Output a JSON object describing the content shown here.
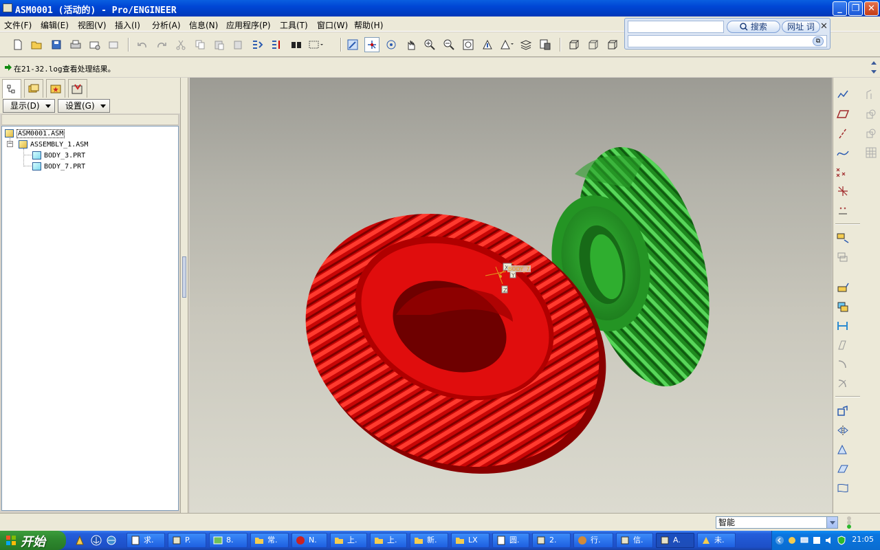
{
  "window": {
    "title": "ASM0001 (活动的) - Pro/ENGINEER",
    "buttons": {
      "minimize": "_",
      "maximize": "❐",
      "close": "✕"
    }
  },
  "menu": [
    "文件(F)",
    "编辑(E)",
    "视图(V)",
    "插入(I)",
    "分析(A)",
    "信息(N)",
    "应用程序(P)",
    "工具(T)",
    "窗口(W)",
    "帮助(H)"
  ],
  "search_widget": {
    "search_label": "搜索",
    "url_label": "网址 词",
    "close": "✕"
  },
  "message_line": {
    "text": "在21-32.log查看处理结果。"
  },
  "navigator": {
    "show_label": "显示(D)",
    "settings_label": "设置(G)",
    "tree": [
      {
        "label": "ASM0001.ASM",
        "kind": "asm"
      },
      {
        "label": "ASSEMBLY_1.ASM",
        "kind": "asm",
        "toggle": "−"
      },
      {
        "label": "BODY_3.PRT",
        "kind": "prt"
      },
      {
        "label": "BODY_7.PRT",
        "kind": "prt"
      }
    ]
  },
  "viewport": {
    "csys_label": "BODY_7",
    "axis_labels": {
      "x": "X",
      "y": "Y",
      "z": "Z"
    },
    "gear_colors": {
      "large": "#d50a0a",
      "small": "#2a9e2a"
    }
  },
  "statusbar": {
    "filter_value": "智能"
  },
  "taskbar": {
    "start_label": "开始",
    "tasks": [
      {
        "label": "求.",
        "icon": "doc-icon"
      },
      {
        "label": "P.",
        "icon": "proe-icon"
      },
      {
        "label": "8.",
        "icon": "image-icon"
      },
      {
        "label": "常.",
        "icon": "folder-icon"
      },
      {
        "label": "N.",
        "icon": "app-icon"
      },
      {
        "label": "上.",
        "icon": "folder-icon"
      },
      {
        "label": "上.",
        "icon": "folder-icon"
      },
      {
        "label": "新.",
        "icon": "folder-icon"
      },
      {
        "label": "LX",
        "icon": "folder-icon"
      },
      {
        "label": "圆.",
        "icon": "doc-icon"
      },
      {
        "label": "2.",
        "icon": "proe-icon"
      },
      {
        "label": "行.",
        "icon": "app-icon"
      },
      {
        "label": "信.",
        "icon": "proe-icon"
      },
      {
        "label": "A.",
        "icon": "proe-icon",
        "active": true
      },
      {
        "label": "未.",
        "icon": "app-icon"
      }
    ],
    "clock": "21:05"
  }
}
